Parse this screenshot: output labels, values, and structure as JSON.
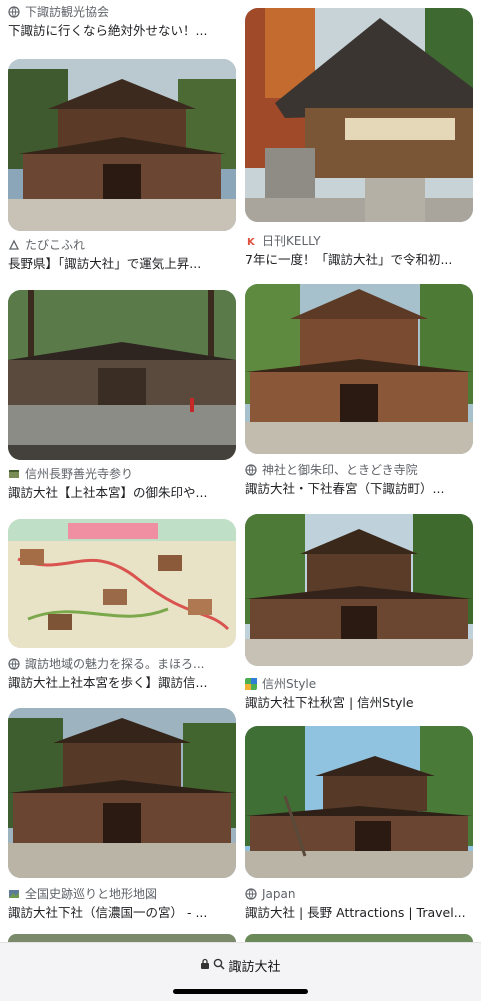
{
  "results_left": [
    {
      "source": "下諏訪観光協会",
      "source_icon": "globe-icon",
      "title": "下諏訪に行くなら絶対外せない！..."
    },
    {
      "source": "たびこふれ",
      "source_icon": "tabikofure-icon",
      "title": "長野県】「諏訪大社」で運気上昇..."
    },
    {
      "source": "信州長野善光寺参り",
      "source_icon": "site-logo-icon",
      "title": "諏訪大社【上社本宮】の御朱印や..."
    },
    {
      "source": "諏訪地域の魅力を探る。まほろ...",
      "source_icon": "globe-icon",
      "title": "諏訪大社上社本宮を歩く】諏訪信..."
    },
    {
      "source": "全国史跡巡りと地形地図",
      "source_icon": "site-logo-icon",
      "title": "諏訪大社下社（信濃国一の宮） - ..."
    }
  ],
  "results_right": [
    {
      "source": "日刊KELLY",
      "source_icon": "kelly-icon",
      "title": "7年に一度！「諏訪大社」で令和初..."
    },
    {
      "source": "神社と御朱印、ときどき寺院",
      "source_icon": "globe-icon",
      "title": "諏訪大社・下社春宮（下諏訪町）..."
    },
    {
      "source": "信州Style",
      "source_icon": "shinshu-style-icon",
      "title": "諏訪大社下社秋宮 | 信州Style"
    },
    {
      "source": "Japan",
      "source_icon": "globe-icon",
      "title": "諏訪大社 | 長野 Attractions | Travel..."
    }
  ],
  "address_bar": {
    "text": "諏訪大社",
    "lock_icon": "lock-icon",
    "search_icon": "search-icon"
  },
  "colors": {
    "bar_bg": "#f4f4f6",
    "text": "#202124",
    "source_text": "#5f6368"
  }
}
